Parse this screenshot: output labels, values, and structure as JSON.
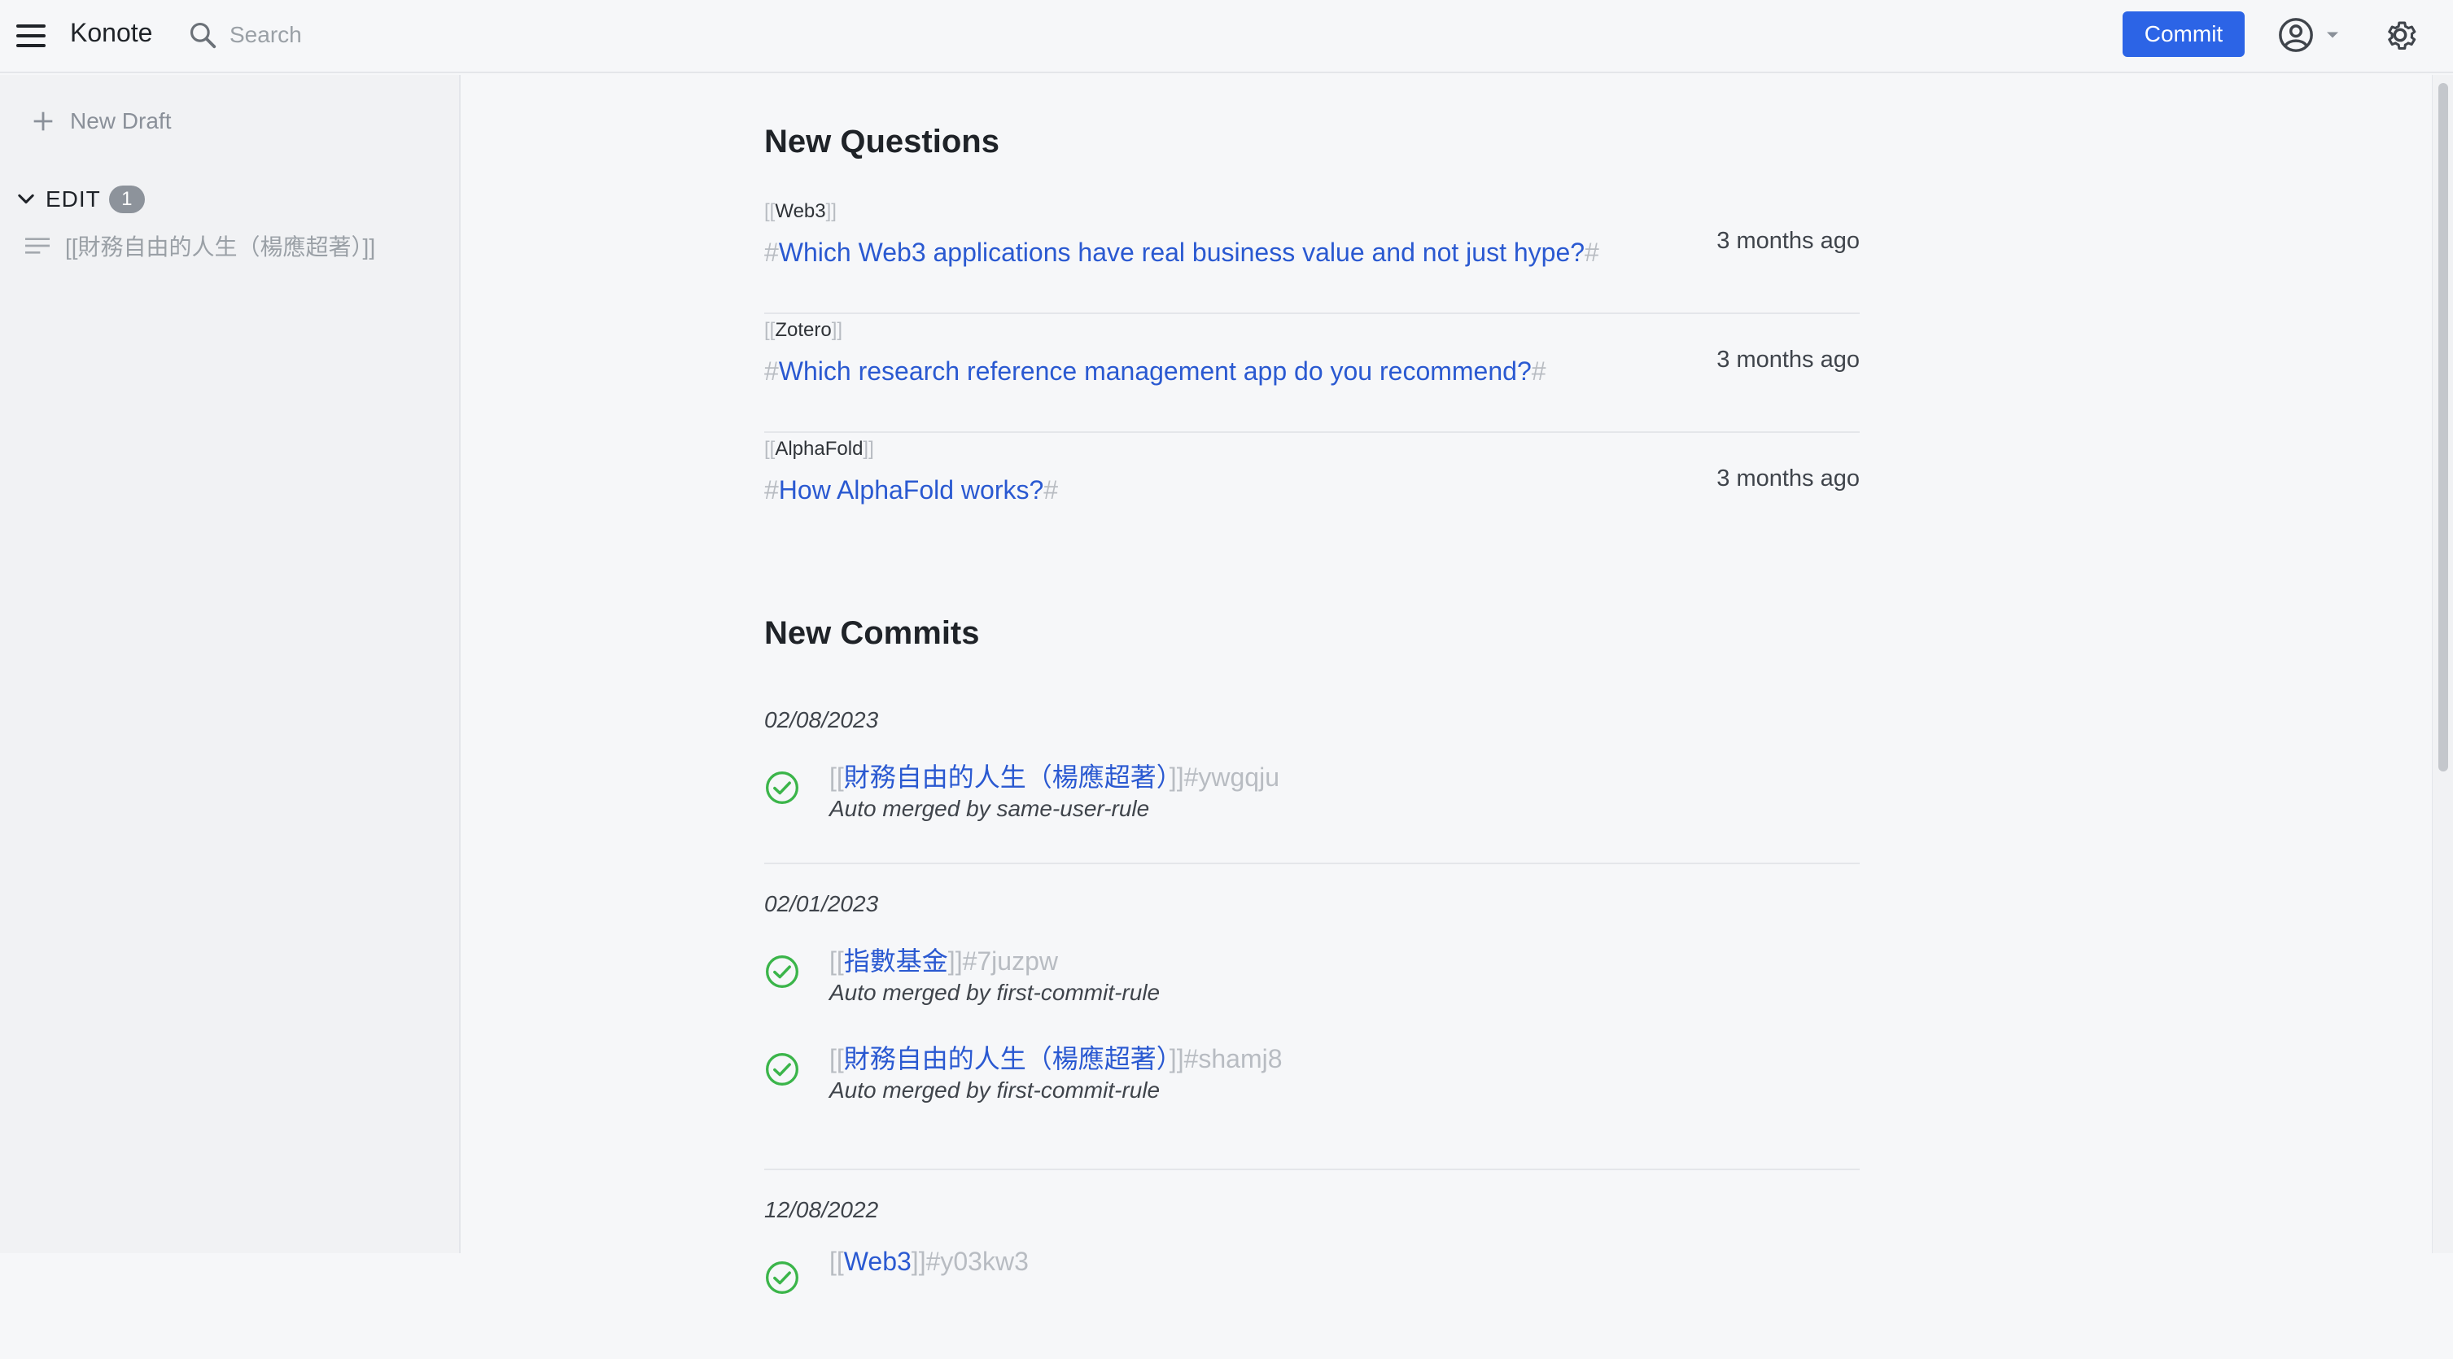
{
  "app": {
    "title": "Konote"
  },
  "header": {
    "search_placeholder": "Search",
    "commit_label": "Commit"
  },
  "sidebar": {
    "new_draft_label": "New Draft",
    "edit_label": "EDIT",
    "edit_count": "1",
    "drafts": [
      {
        "text": "[[財務自由的人生（楊應超著）]]"
      }
    ]
  },
  "questions": {
    "title": "New Questions",
    "items": [
      {
        "tag": "Web3",
        "text": "Which Web3 applications have real business value and not just hype?",
        "time": "3 months ago"
      },
      {
        "tag": "Zotero",
        "text": "Which research reference management app do you recommend?",
        "time": "3 months ago"
      },
      {
        "tag": "AlphaFold",
        "text": "How AlphaFold works?",
        "time": "3 months ago"
      }
    ]
  },
  "commits": {
    "title": "New Commits",
    "groups": [
      {
        "date": "02/08/2023",
        "items": [
          {
            "name": "財務自由的人生（楊應超著）",
            "id": "#ywgqju",
            "rule": "Auto merged by same-user-rule"
          }
        ]
      },
      {
        "date": "02/01/2023",
        "items": [
          {
            "name": "指數基金",
            "id": "#7juzpw",
            "rule": "Auto merged by first-commit-rule"
          },
          {
            "name": "財務自由的人生（楊應超著）",
            "id": "#shamj8",
            "rule": "Auto merged by first-commit-rule"
          }
        ]
      },
      {
        "date": "12/08/2022",
        "items": [
          {
            "name": "Web3",
            "id": "#y03kw3",
            "rule": ""
          }
        ]
      }
    ]
  },
  "colors": {
    "accent": "#2c64e6",
    "link": "#2a59d1",
    "success": "#3bb54a"
  }
}
